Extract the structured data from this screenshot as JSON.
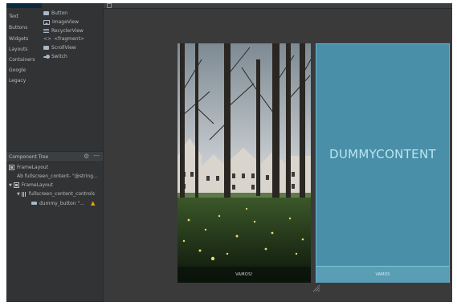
{
  "palette": {
    "categories": [
      "",
      "Text",
      "Buttons",
      "Widgets",
      "Layouts",
      "Containers",
      "Google",
      "Legacy"
    ],
    "widgets": [
      {
        "label": "Button",
        "icon": "button-icon"
      },
      {
        "label": "ImageView",
        "icon": "imageview-icon"
      },
      {
        "label": "RecyclerView",
        "icon": "recyclerview-icon"
      },
      {
        "label": "<fragment>",
        "icon": "fragment-icon"
      },
      {
        "label": "ScrollView",
        "icon": "scrollview-icon"
      },
      {
        "label": "Switch",
        "icon": "switch-icon"
      }
    ]
  },
  "component_tree": {
    "title": "Component Tree",
    "rows": [
      {
        "label": "FrameLayout"
      },
      {
        "label": "Ab fullscreen_content- \"@string..."
      },
      {
        "label": "FrameLayout"
      },
      {
        "label": "fullscreen_content_controls"
      },
      {
        "label": "dummy_button \"..."
      }
    ]
  },
  "design": {
    "button_label": "VAMOS!"
  },
  "blueprint": {
    "content_text": "DUMMYCONTENT",
    "button_label": "VAMOS"
  },
  "colors": {
    "blueprint_bg": "#4a8fa8",
    "warning": "#f0a30a"
  }
}
